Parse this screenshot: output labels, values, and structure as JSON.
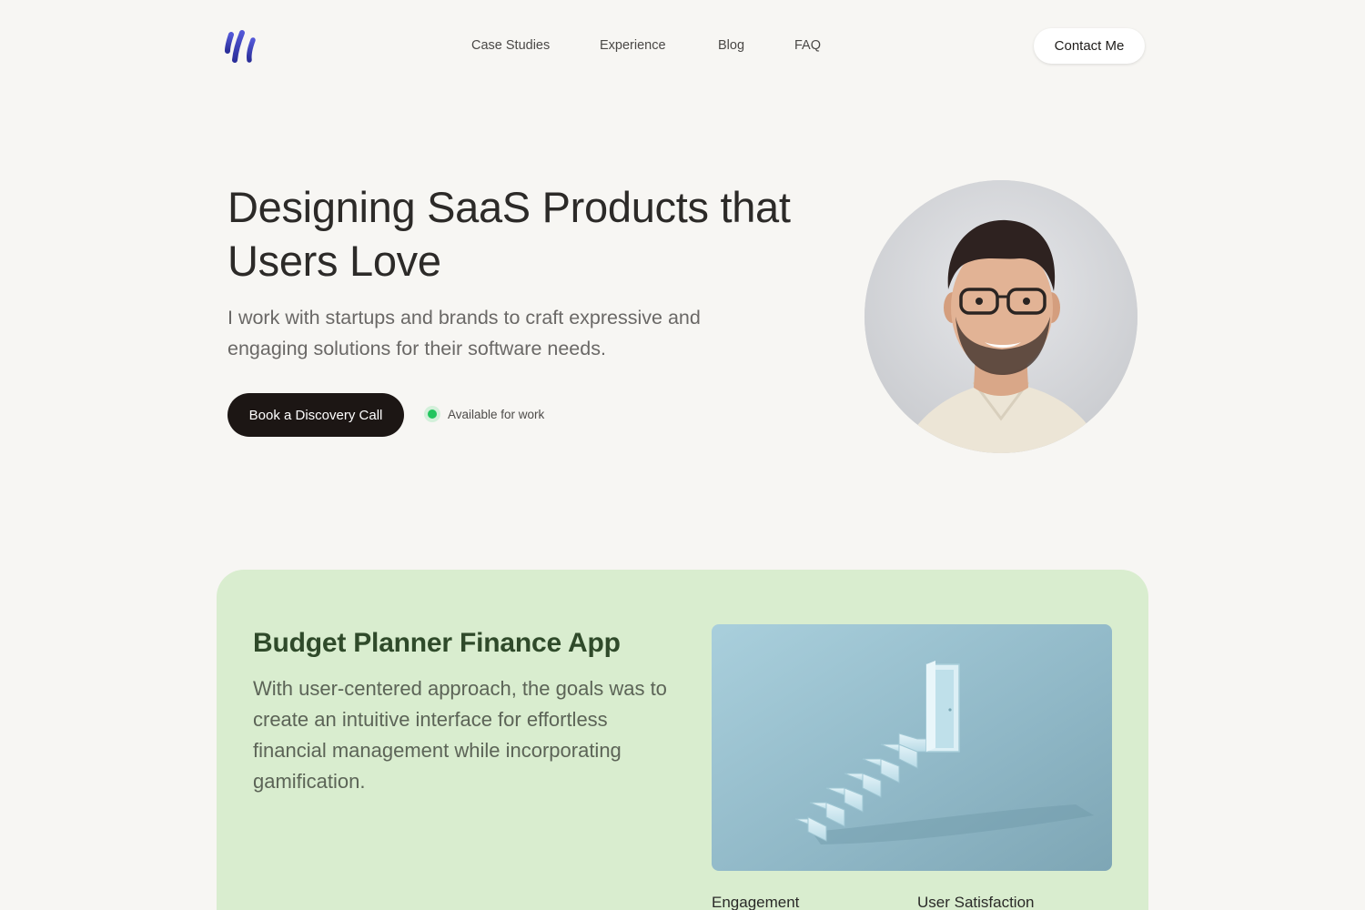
{
  "header": {
    "logo_icon": "stylized-slash-logo",
    "nav": [
      "Case Studies",
      "Experience",
      "Blog",
      "FAQ"
    ],
    "contact_label": "Contact Me"
  },
  "hero": {
    "title_line1": "Designing SaaS Products that",
    "title_line2": "Users Love",
    "subtitle_line1": "I work with startups and brands to craft expressive and",
    "subtitle_line2": "engaging solutions for their software needs.",
    "cta_label": "Book a Discovery Call",
    "status_text": "Available for work",
    "status_color": "#22c55e"
  },
  "case_study": {
    "title": "Budget Planner Finance App",
    "description": "With user-centered approach, the goals was to create an intuitive interface for effortless financial management while incorporating gamification.",
    "image_icon": "staircase-door-illustration",
    "metrics": [
      "Engagement",
      "User Satisfaction"
    ],
    "background": "#d9edcf"
  },
  "colors": {
    "page_bg": "#f7f6f3",
    "cta_bg": "#1c1614",
    "logo": "#3b3fb0"
  }
}
